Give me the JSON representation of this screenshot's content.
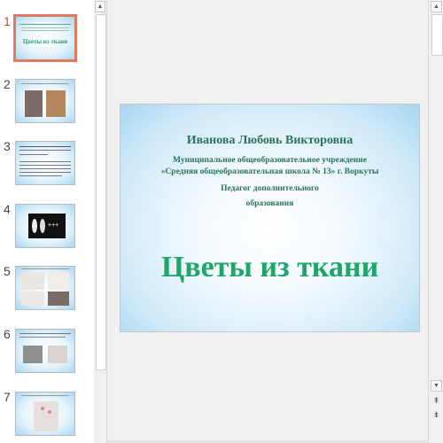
{
  "thumbnails": [
    {
      "number": "1",
      "title": "Цветы из ткани",
      "active": true
    },
    {
      "number": "2",
      "active": false
    },
    {
      "number": "3",
      "active": false
    },
    {
      "number": "4",
      "active": false
    },
    {
      "number": "5",
      "active": false
    },
    {
      "number": "6",
      "active": false
    },
    {
      "number": "7",
      "active": false
    }
  ],
  "slide": {
    "author": "Иванова Любовь Викторовна",
    "institution_line1": "Муниципальное общеобразовательное учреждение",
    "institution_line2": "«Средняя общеобразовательная школа № 13» г. Воркуты",
    "position_line1": "Педагог дополнительного",
    "position_line2": "образования",
    "title": "Цветы из ткани"
  },
  "colors": {
    "accent_active": "#e07a5f",
    "title_green": "#1fa76a",
    "text_green": "#2a7258"
  },
  "icons": {
    "scroll_up": "▲",
    "scroll_down": "▼",
    "prev_slide": "⇞",
    "next_slide": "⇟"
  }
}
